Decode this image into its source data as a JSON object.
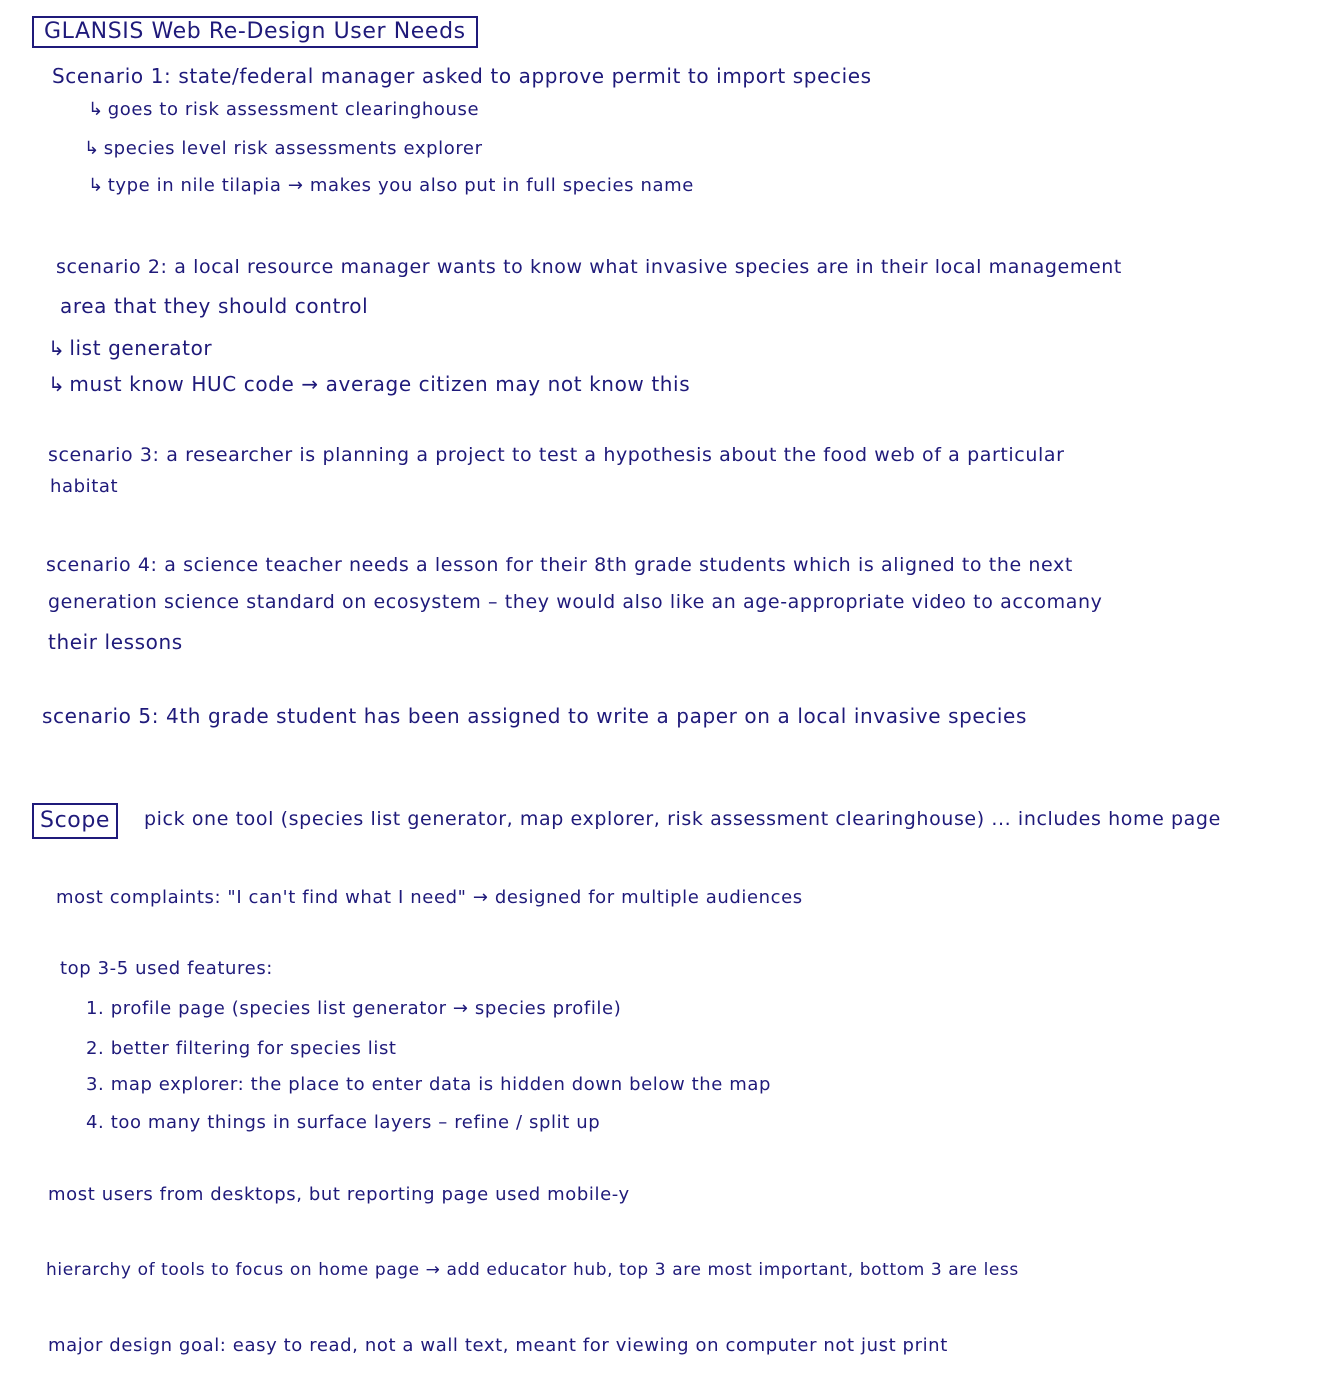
{
  "title": "GLANSIS Web Re-Design User Needs",
  "scenarios": [
    {
      "label": "scenario 1",
      "line": "Scenario 1: state/federal manager asked to approve permit to import species",
      "steps": [
        "goes to risk assessment clearinghouse",
        "species level risk assessments explorer",
        "type in nile tilapia → makes you also put in full species name"
      ]
    },
    {
      "label": "scenario 2",
      "line1": "scenario 2: a local resource manager wants to know what invasive species are in their local management",
      "line2": "area that they should control",
      "steps": [
        "list generator",
        "must know HUC code → average citizen may not know this"
      ]
    },
    {
      "label": "scenario 3",
      "line1": "scenario 3: a researcher is planning a project to test a hypothesis about the food web of a particular",
      "line2": "habitat"
    },
    {
      "label": "scenario 4",
      "line1": "scenario 4: a science teacher needs a lesson for their 8th grade students which is aligned to the next",
      "line2": "generation science standard on ecosystem – they would also like an age-appropriate video to accomany",
      "line3": "their lessons"
    },
    {
      "label": "scenario 5",
      "line1": "scenario 5: 4th grade student has been assigned to write a paper on a local invasive species"
    }
  ],
  "scope": {
    "label": "Scope",
    "text": "pick one tool (species list generator, map explorer, risk assessment clearinghouse) ... includes home page"
  },
  "complaints": "most complaints: \"I can't find what I need\" → designed for multiple audiences",
  "features": {
    "heading": "top 3-5 used features:",
    "items": [
      "1. profile page (species list generator → species profile)",
      "2. better filtering for species list",
      "3. map explorer: the place to enter data is hidden down below the map",
      "4. too many things in surface layers – refine / split up"
    ]
  },
  "notes": [
    "most users from desktops, but reporting page used mobile-y",
    "hierarchy of tools to focus on home page → add educator hub, top 3 are most important, bottom 3 are less",
    "major design goal: easy to read, not a wall text, meant for viewing on computer not just print"
  ],
  "sub_arrow": "↳"
}
